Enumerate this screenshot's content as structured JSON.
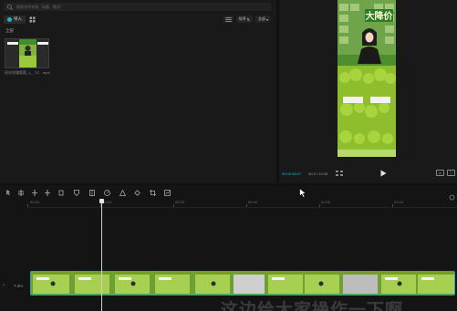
{
  "media": {
    "search_placeholder": "搜索文件名称、标题、歌词",
    "import_label": "导入",
    "sort_label": "排序",
    "filter_label": "全部",
    "section_title": "全部",
    "clip_name": "阳光玫瑰葡萄_1_（1）.mp4",
    "clip_duration": "01:59"
  },
  "player": {
    "current_time": "00:00:08:27",
    "total_time": "00:17:12:08"
  },
  "timeline": {
    "ruler_labels": [
      "00:00",
      "00:15",
      "00:30",
      "00:45",
      "01:00",
      "01:15"
    ],
    "track_label": "7.4m",
    "subtitle_overlay": "这边给大家操作一下啊"
  },
  "colors": {
    "accent": "#20b4c9",
    "panel_bg": "#191919",
    "clip_border": "#2aa5b8",
    "grape_green": "#8bbd2f"
  },
  "icons": {
    "search": "search-icon",
    "import": "plus-icon",
    "grid": "grid-icon",
    "play": "play-icon",
    "cursor": "mouse-cursor-icon"
  }
}
